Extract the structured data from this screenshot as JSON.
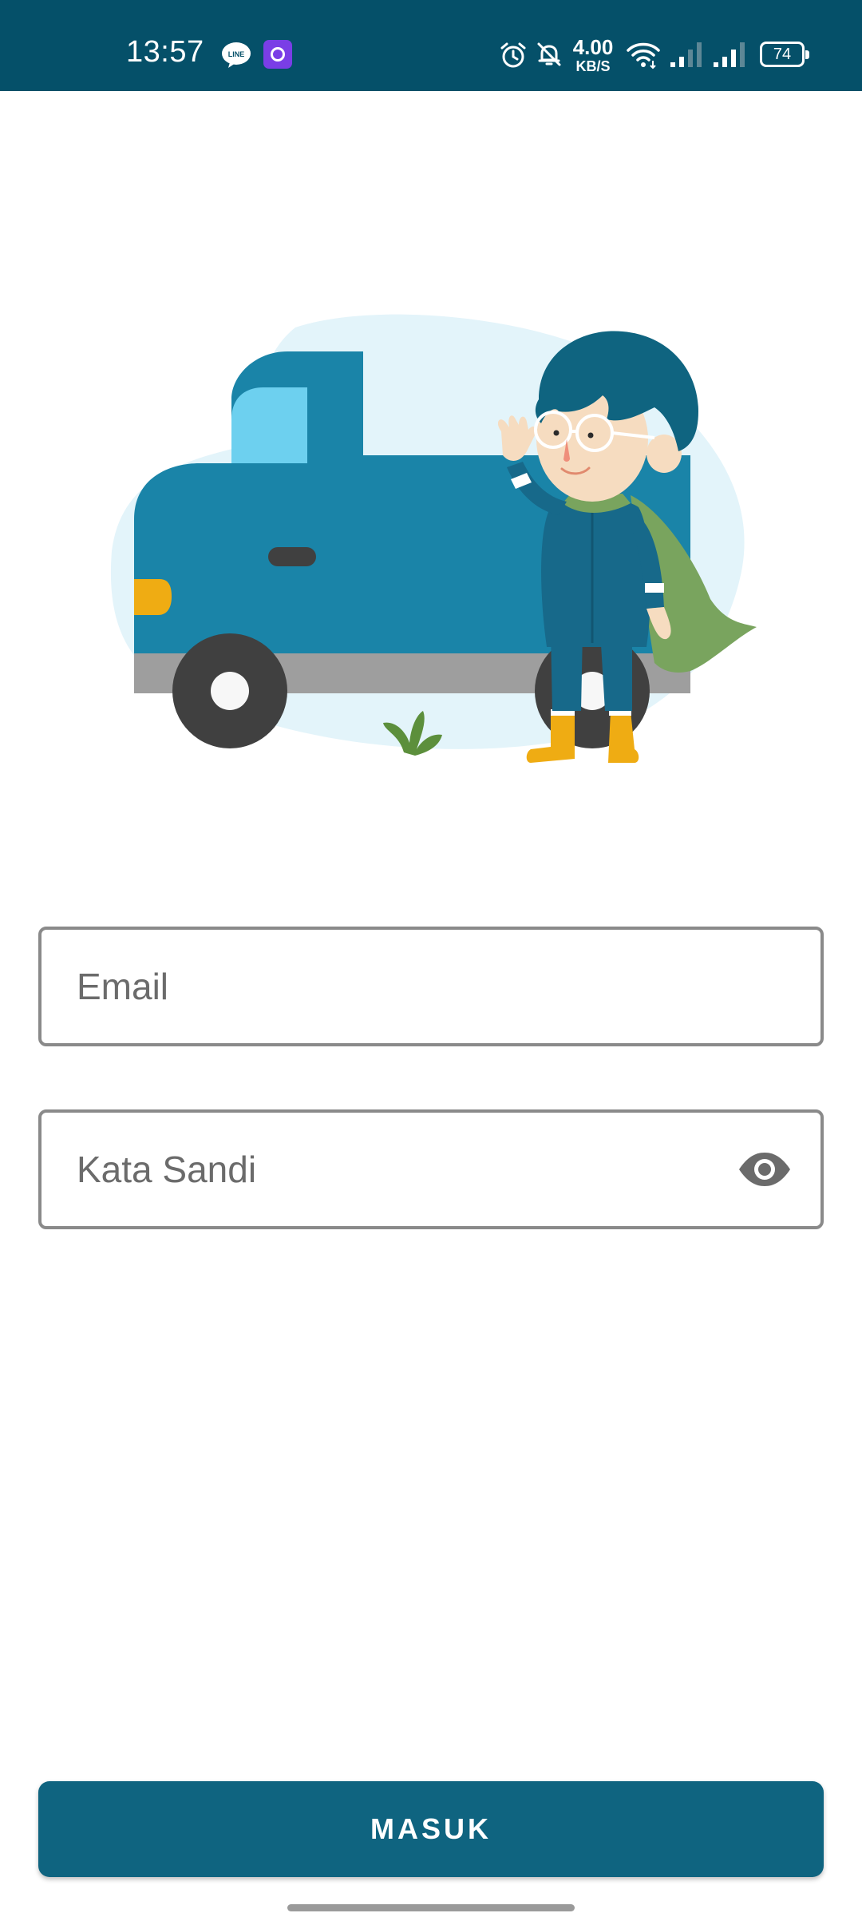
{
  "status_bar": {
    "time": "13:57",
    "net_speed_value": "4.00",
    "net_speed_unit": "KB/S",
    "battery_level": "74",
    "background_color": "#055069",
    "icons": [
      "line-icon",
      "app-notification-icon",
      "alarm-icon",
      "mute-icon",
      "wifi-icon",
      "signal-icon",
      "signal-icon",
      "battery-icon"
    ]
  },
  "illustration": {
    "icon": "delivery-truck-driver-illustration"
  },
  "form": {
    "email_placeholder": "Email",
    "password_placeholder": "Kata Sandi",
    "password_toggle_icon": "eye-icon"
  },
  "login_button": {
    "label": "MASUK",
    "color": "#0f6480"
  }
}
